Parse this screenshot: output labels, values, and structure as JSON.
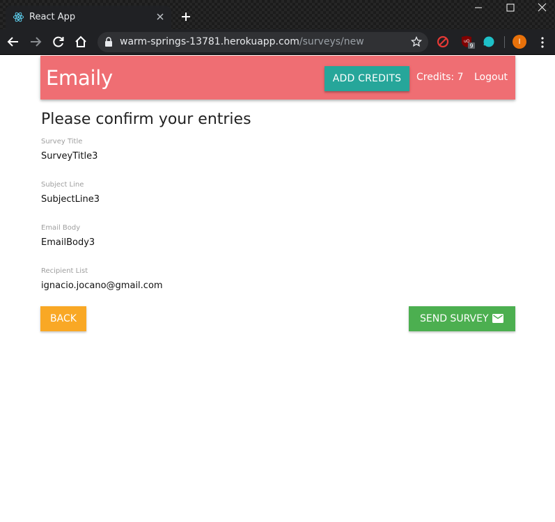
{
  "browser": {
    "tab_title": "React App",
    "url_host": "warm-springs-13781.herokuapp.com",
    "url_path": "/surveys/new",
    "profile_initial": "I",
    "ext_badge": "9"
  },
  "header": {
    "brand": "Emaily",
    "add_credits_label": "ADD CREDITS",
    "credits_text": "Credits: 7",
    "logout_label": "Logout"
  },
  "review": {
    "heading": "Please confirm your entries",
    "fields": [
      {
        "label": "Survey Title",
        "value": "SurveyTitle3"
      },
      {
        "label": "Subject Line",
        "value": "SubjectLine3"
      },
      {
        "label": "Email Body",
        "value": "EmailBody3"
      },
      {
        "label": "Recipient List",
        "value": "ignacio.jocano@gmail.com"
      }
    ],
    "back_label": "BACK",
    "send_label": "SEND SURVEY",
    "send_icon": "mail-icon"
  },
  "colors": {
    "navbar": "#ef6e73",
    "add_credits": "#26a69a",
    "back": "#f9a825",
    "send": "#4caf50"
  }
}
